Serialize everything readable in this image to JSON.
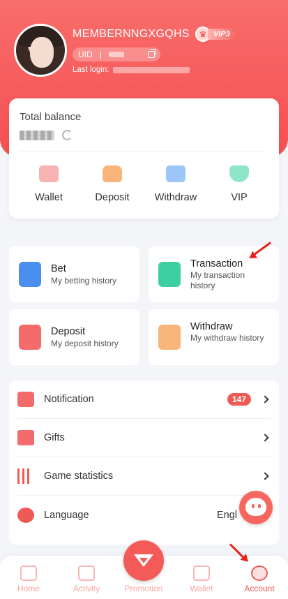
{
  "profile": {
    "username": "MEMBERNNGXGQHS",
    "vip_level": "VIP3",
    "uid_label": "UID",
    "uid_separator": "|",
    "last_login_label": "Last login:"
  },
  "balance": {
    "label": "Total balance"
  },
  "quick_actions": [
    {
      "label": "Wallet",
      "icon": "wallet-icon",
      "color": "#f36b6b"
    },
    {
      "label": "Deposit",
      "icon": "deposit-icon",
      "color": "#f59a4d"
    },
    {
      "label": "Withdraw",
      "icon": "withdraw-icon",
      "color": "#5aa0f0"
    },
    {
      "label": "VIP",
      "icon": "vip-icon",
      "color": "#3dcfa2"
    }
  ],
  "history_cards": [
    {
      "title": "Bet",
      "subtitle": "My betting history",
      "icon": "bet-history-icon",
      "color": "#4a8ef0"
    },
    {
      "title": "Transaction",
      "subtitle": "My transaction history",
      "icon": "transaction-icon",
      "color": "#3dcfa2"
    },
    {
      "title": "Deposit",
      "subtitle": "My deposit history",
      "icon": "deposit-history-icon",
      "color": "#f36b6b"
    },
    {
      "title": "Withdraw",
      "subtitle": "My withdraw history",
      "icon": "withdraw-history-icon",
      "color": "#f59a4d"
    }
  ],
  "menu": [
    {
      "label": "Notification",
      "badge": "147",
      "icon": "bell-icon"
    },
    {
      "label": "Gifts",
      "icon": "gift-icon"
    },
    {
      "label": "Game statistics",
      "icon": "stats-icon"
    },
    {
      "label": "Language",
      "value": "Engl",
      "icon": "globe-icon"
    }
  ],
  "tabbar": {
    "items": [
      {
        "label": "Home",
        "icon": "home-icon"
      },
      {
        "label": "Activity",
        "icon": "activity-icon"
      },
      {
        "label": "Promotion",
        "icon": "promotion-icon"
      },
      {
        "label": "Wallet",
        "icon": "wallet-icon"
      },
      {
        "label": "Account",
        "icon": "account-icon",
        "active": true
      }
    ]
  },
  "colors": {
    "brand": "#f45b58",
    "annotation_arrow": "#e8201b"
  }
}
